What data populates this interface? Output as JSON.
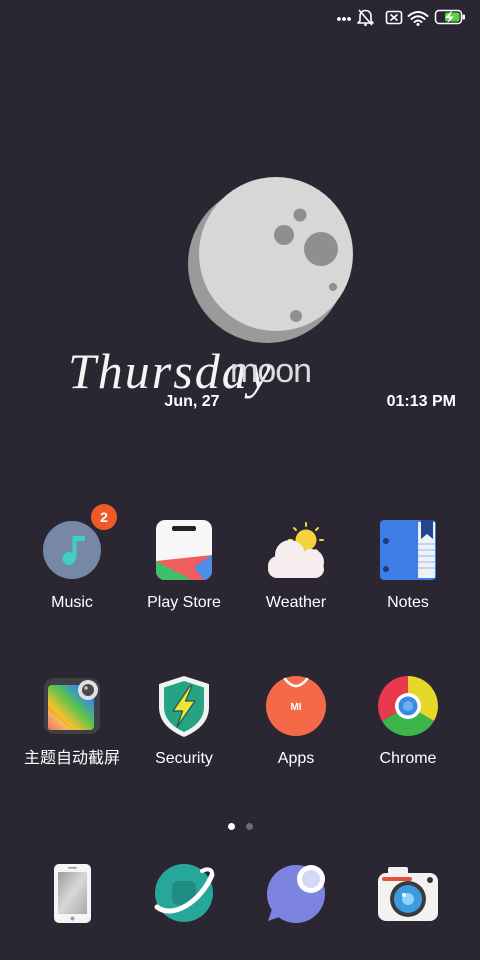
{
  "theme": {
    "background": "#2a2733",
    "label_color": "#ffffff",
    "badge_color": "#f05a28"
  },
  "status_bar": {
    "icons": [
      "more-dots-icon",
      "notifications-muted-icon",
      "no-sim-icon",
      "wifi-icon",
      "battery-charging-icon"
    ]
  },
  "widget": {
    "day": "Thursday",
    "label": "moon",
    "date": "Jun, 27",
    "time": "01:13 PM"
  },
  "apps": [
    {
      "label": "Music",
      "icon": "music-icon",
      "badge": "2"
    },
    {
      "label": "Play Store",
      "icon": "play-store-icon"
    },
    {
      "label": "Weather",
      "icon": "weather-icon"
    },
    {
      "label": "Notes",
      "icon": "notes-icon"
    },
    {
      "label": "主题自动截屏",
      "icon": "theme-screenshot-icon"
    },
    {
      "label": "Security",
      "icon": "security-shield-icon"
    },
    {
      "label": "Apps",
      "icon": "mi-apps-icon",
      "logo_text": "MI"
    },
    {
      "label": "Chrome",
      "icon": "chrome-icon"
    }
  ],
  "page_indicator": {
    "page_count": 2,
    "active_page": 1
  },
  "dock": [
    {
      "icon": "phone-icon"
    },
    {
      "icon": "browser-icon"
    },
    {
      "icon": "messages-icon"
    },
    {
      "icon": "camera-icon"
    }
  ]
}
